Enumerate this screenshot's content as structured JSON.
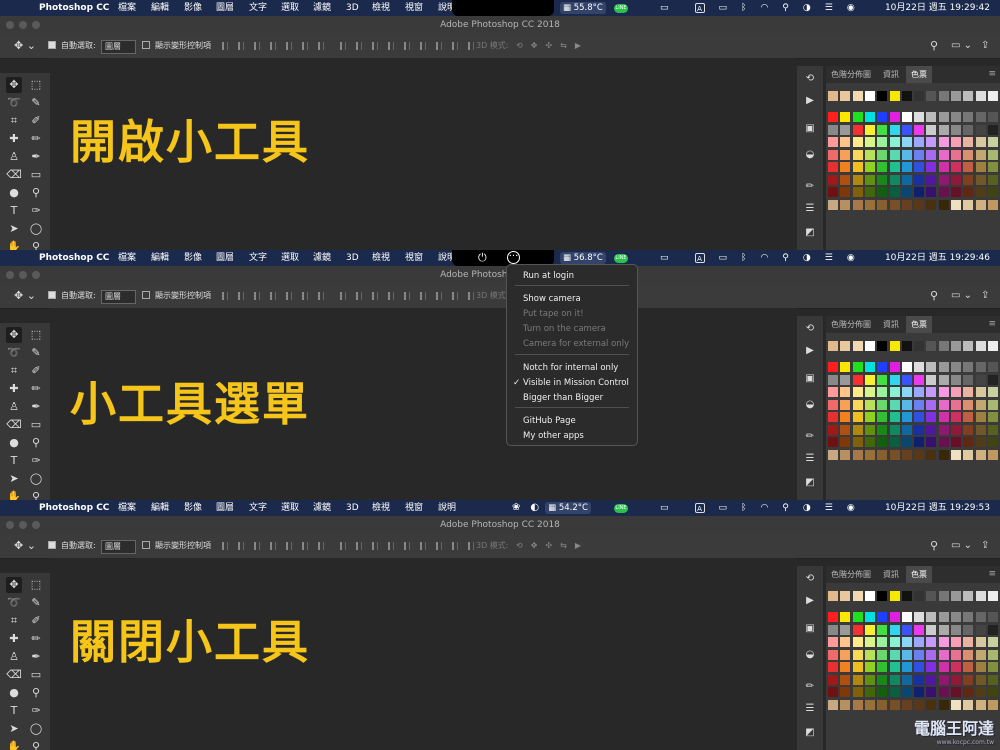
{
  "menubar": {
    "app_name": "Photoshop CC",
    "menus": [
      "檔案",
      "編輯",
      "影像",
      "圖層",
      "文字",
      "選取",
      "濾鏡",
      "3D",
      "檢視",
      "視窗",
      "說明"
    ]
  },
  "window_title": "Adobe Photoshop CC 2018",
  "options_bar": {
    "auto_select_label": "自動選取:",
    "auto_select_value": "圖層",
    "show_transform_label": "顯示變形控制項",
    "mode_3d_label": "3D 模式:"
  },
  "swatch_panel": {
    "tabs": [
      "色階分佈圖",
      "資訊",
      "色票"
    ],
    "active_tab": "色票"
  },
  "panels": [
    {
      "heading": "開啟小工具",
      "temperature": "55.8°C",
      "clock": "10月22日 週五 19:29:42"
    },
    {
      "heading": "小工具選單",
      "temperature": "56.8°C",
      "clock": "10月22日 週五 19:29:46"
    },
    {
      "heading": "關閉小工具",
      "temperature": "54.2°C",
      "clock": "10月22日 週五 19:29:53"
    }
  ],
  "notch_menu": {
    "items": [
      {
        "label": "Run at login",
        "enabled": true,
        "checked": false
      },
      {
        "label": "Show camera",
        "enabled": true,
        "checked": false
      },
      {
        "label": "Put tape on it!",
        "enabled": false,
        "checked": false
      },
      {
        "label": "Turn on the camera",
        "enabled": false,
        "checked": false
      },
      {
        "label": "Camera for external only",
        "enabled": false,
        "checked": false
      },
      {
        "label": "Notch for internal only",
        "enabled": true,
        "checked": false
      },
      {
        "label": "Visible in Mission Control",
        "enabled": true,
        "checked": true
      },
      {
        "label": "Bigger than Bigger",
        "enabled": true,
        "checked": false
      },
      {
        "label": "GitHub Page",
        "enabled": true,
        "checked": false
      },
      {
        "label": "My other apps",
        "enabled": true,
        "checked": false
      }
    ],
    "checkmark": "✓"
  },
  "tray_icons": [
    "app-icon",
    "temperature-icon",
    "line-icon",
    "notification-icon",
    "input-method-a",
    "battery-icon",
    "bluetooth-icon",
    "wifi-icon",
    "search-icon",
    "focus-icon",
    "control-center-icon",
    "siri-icon"
  ],
  "input_method": "A",
  "line_label": "LINE",
  "watermark": {
    "title": "電腦王阿達",
    "url": "www.kocpc.com.tw"
  },
  "colors": {
    "menubar": "#1b2a4c",
    "heading": "#f6c51a",
    "app_bg": "#282828"
  }
}
